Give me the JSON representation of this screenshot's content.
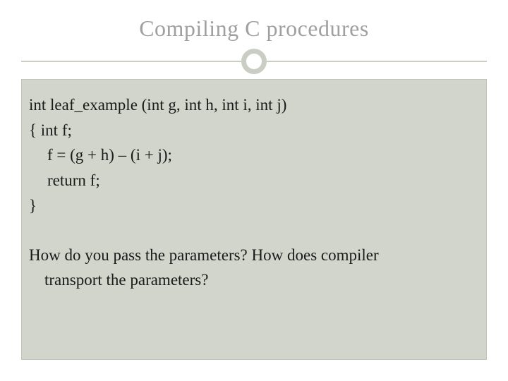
{
  "title": "Compiling C procedures",
  "code": {
    "line1": "int leaf_example (int g, int h, int i, int j)",
    "line2": "{  int f;",
    "line3": "f = (g + h) – (i + j);",
    "line4": "return f;",
    "line5": "}"
  },
  "question": "How do you pass the parameters? How does compiler",
  "question_cont": "transport the parameters?"
}
